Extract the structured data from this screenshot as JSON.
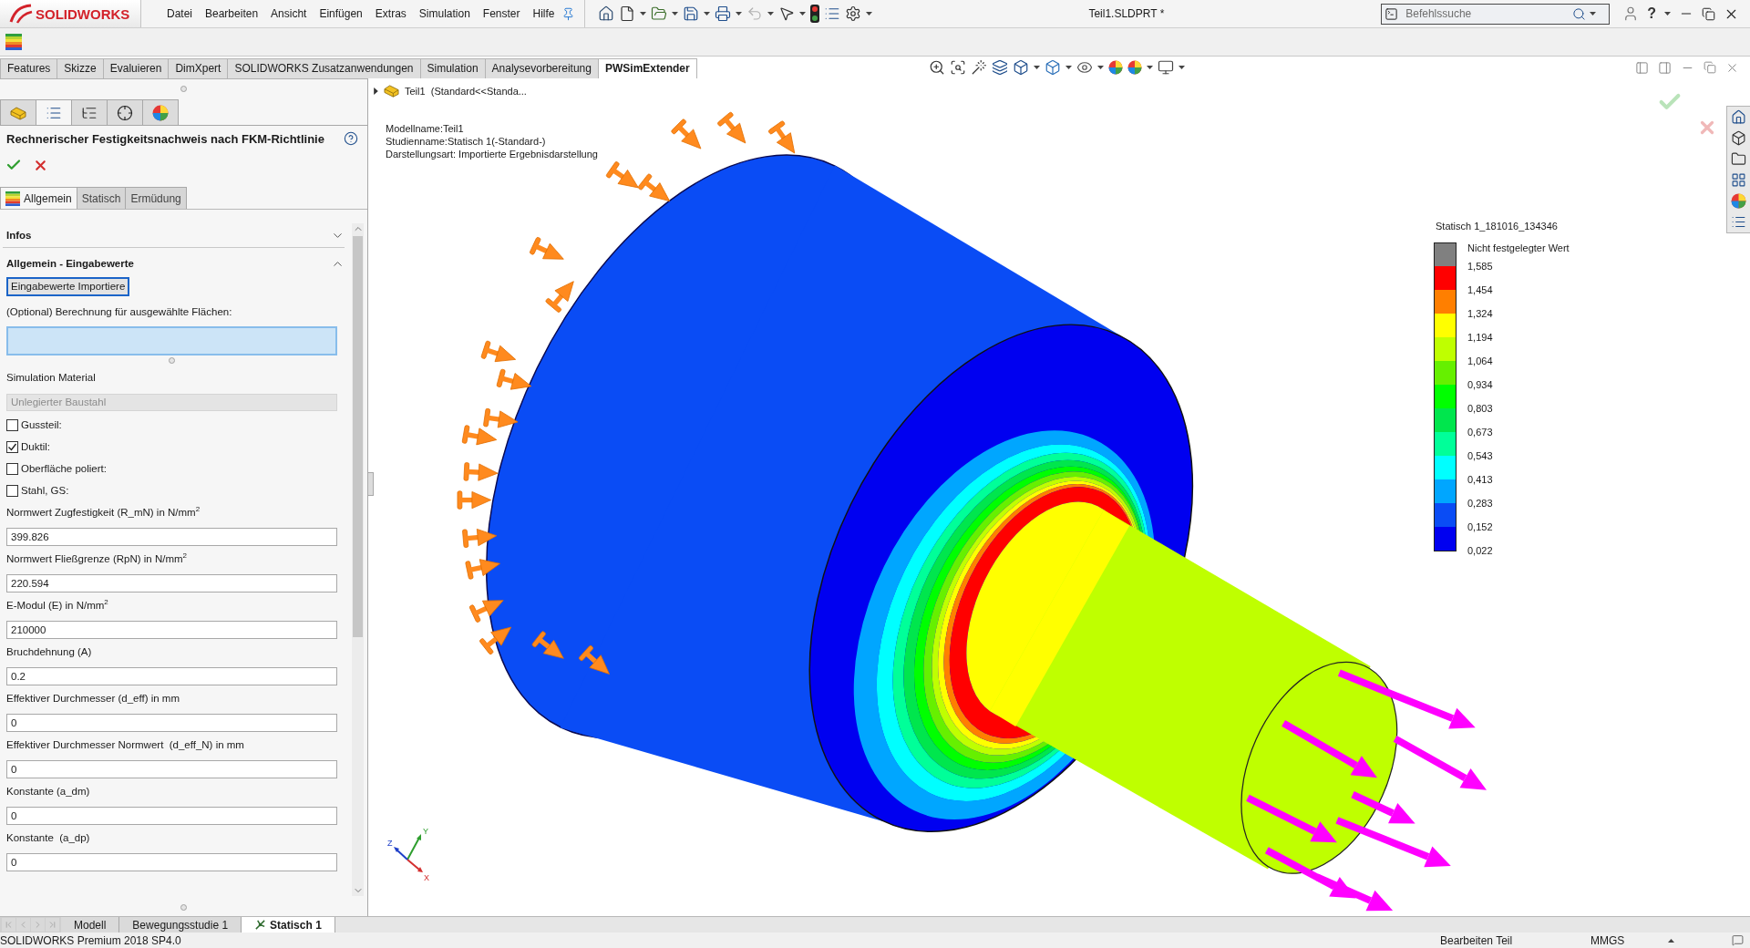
{
  "titlebar": {
    "logo": "SOLIDWORKS",
    "menu": [
      "Datei",
      "Bearbeiten",
      "Ansicht",
      "Einfügen",
      "Extras",
      "Simulation",
      "Fenster",
      "Hilfe"
    ],
    "title": "Teil1.SLDPRT *",
    "search": {
      "placeholder": "Befehlssuche"
    },
    "help": "?"
  },
  "command_tabs": [
    {
      "label": "Features",
      "selected": false
    },
    {
      "label": "Skizze",
      "selected": false
    },
    {
      "label": "Evaluieren",
      "selected": false
    },
    {
      "label": "DimXpert",
      "selected": false
    },
    {
      "label": "SOLIDWORKS Zusatzanwendungen",
      "selected": false
    },
    {
      "label": "Simulation",
      "selected": false
    },
    {
      "label": "Analysevorbereitung",
      "selected": false
    },
    {
      "label": "PWSimExtender",
      "selected": true
    }
  ],
  "panel": {
    "tabs": [
      {
        "kind": "part",
        "selected": false
      },
      {
        "kind": "properties",
        "selected": true
      },
      {
        "kind": "configurations",
        "selected": false
      },
      {
        "kind": "dimxpert",
        "selected": false
      },
      {
        "kind": "appearance",
        "selected": false
      }
    ],
    "title": "Rechnerischer Festigkeitsnachweis nach FKM-Richtlinie",
    "subtabs": [
      {
        "label": "Allgemein",
        "selected": true,
        "icon": true
      },
      {
        "label": "Statisch",
        "selected": false
      },
      {
        "label": "Ermüdung",
        "selected": false
      }
    ],
    "sections": [
      {
        "title": "Infos",
        "expanded": false
      },
      {
        "title": "Allgemein - Eingabewerte",
        "expanded": true,
        "items": [
          {
            "kind": "button",
            "label": "Eingabewerte Importiere"
          },
          {
            "kind": "selection",
            "label": "(Optional) Berechnung für ausgewählte Flächen:",
            "active": true
          },
          {
            "kind": "select",
            "label": "Simulation Material",
            "value": "Unlegierter Baustahl",
            "disabled": true
          },
          {
            "kind": "checkbox",
            "label": "Gussteil:",
            "checked": false
          },
          {
            "kind": "checkbox",
            "label": "Duktil:",
            "checked": true
          },
          {
            "kind": "checkbox",
            "label": "Oberfläche poliert:",
            "checked": false
          },
          {
            "kind": "checkbox",
            "label": "Stahl, GS:",
            "checked": false
          },
          {
            "kind": "number",
            "label": "Normwert Zugfestigkeit (R_mN) in N/mm$^{2}$",
            "value": "399.826"
          },
          {
            "kind": "number",
            "label": "Normwert Fließgrenze (RpN) in N/mm$^{2}$",
            "value": "220.594"
          },
          {
            "kind": "number",
            "label": "E-Modul (E) in N/mm$^{2}$",
            "value": "210000"
          },
          {
            "kind": "number",
            "label": "Bruchdehnung (A)",
            "value": "0.2"
          },
          {
            "kind": "number",
            "label": "Effektiver Durchmesser (d_eff) in mm",
            "value": "0"
          },
          {
            "kind": "number",
            "label": "Effektiver Durchmesser Normwert  (d_eff_N) in mm",
            "value": "0"
          },
          {
            "kind": "number",
            "label": "Konstante (a_dm)",
            "value": "0"
          },
          {
            "kind": "number",
            "label": "Konstante  (a_dp)",
            "value": "0"
          }
        ]
      }
    ]
  },
  "viewport": {
    "tree_item": "Teil1  (Standard<<Standa...",
    "info": [
      "Modellname:Teil1",
      "Studienname:Statisch 1(-Standard-)",
      "Darstellungsart: Importierte Ergebnisdarstellung"
    ],
    "legend": {
      "title": "Statisch 1_181016_134346",
      "undefined": {
        "label": "Nicht festgelegter Wert",
        "color": "#808080"
      },
      "bands": [
        {
          "color": "#ff0000"
        },
        {
          "color": "#ff7f00"
        },
        {
          "color": "#ffff00"
        },
        {
          "color": "#bfff00"
        },
        {
          "color": "#66f000"
        },
        {
          "color": "#00ff00"
        },
        {
          "color": "#00e64d"
        },
        {
          "color": "#00ff99"
        },
        {
          "color": "#00ffff"
        },
        {
          "color": "#00a6ff"
        },
        {
          "color": "#0a4cf5"
        },
        {
          "color": "#0000f0"
        }
      ],
      "ticks": [
        "1,585",
        "1,454",
        "1,324",
        "1,194",
        "1,064",
        "0,934",
        "0,803",
        "0,673",
        "0,543",
        "0,413",
        "0,283",
        "0,152",
        "0,022"
      ]
    },
    "triad": {
      "x": "X",
      "y": "Y",
      "z": "Z"
    }
  },
  "model_tabs": [
    {
      "label": "Modell",
      "selected": false
    },
    {
      "label": "Bewegungsstudie 1",
      "selected": false
    },
    {
      "label": "Statisch 1",
      "selected": true,
      "icon": true
    }
  ],
  "status_bar": {
    "version": "SOLIDWORKS Premium 2018 SP4.0",
    "mode": "Bearbeiten Teil",
    "units": "MMGS"
  }
}
